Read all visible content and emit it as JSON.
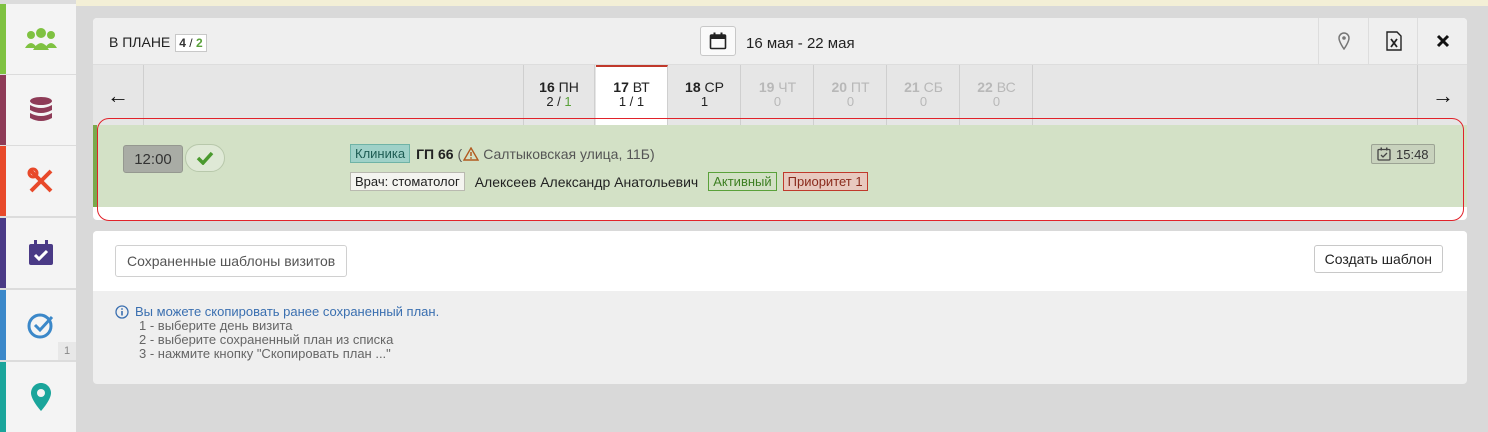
{
  "header": {
    "plan_label": "В ПЛАНЕ",
    "plan_count_total": "4",
    "plan_count_sep": "/",
    "plan_count_done": "2",
    "date_range": "16 мая - 22 мая"
  },
  "days": [
    {
      "num": "16",
      "name": "ПН",
      "count": "2 / 1",
      "state": "normal"
    },
    {
      "num": "17",
      "name": "ВТ",
      "count": "1 / 1",
      "state": "selected"
    },
    {
      "num": "18",
      "name": "СР",
      "count": "1",
      "state": "normal"
    },
    {
      "num": "19",
      "name": "ЧТ",
      "count": "0",
      "state": "off"
    },
    {
      "num": "20",
      "name": "ПТ",
      "count": "0",
      "state": "off"
    },
    {
      "num": "21",
      "name": "СБ",
      "count": "0",
      "state": "off"
    },
    {
      "num": "22",
      "name": "ВС",
      "count": "0",
      "state": "off"
    }
  ],
  "visit": {
    "time": "12:00",
    "type_tag": "Клиника",
    "name": "ГП 66",
    "paren_open": "(",
    "address": "Салтыковская улица, 11Б)",
    "doctor_tag": "Врач: стоматолог",
    "doctor_name": "Алексеев Александр Анатольевич",
    "status_tag": "Активный",
    "priority_tag": "Приоритет 1",
    "created_time": "15:48"
  },
  "templates": {
    "saved_button": "Сохраненные шаблоны визитов",
    "create_button": "Создать шаблон",
    "info_title": "Вы можете скопировать ранее сохраненный план.",
    "steps": [
      "1 - выберите день визита",
      "2 - выберите сохраненный план из списка",
      "3 - нажмите кнопку \"Скопировать план ...\""
    ]
  },
  "sidebar": {
    "badge": "1",
    "colors": [
      "#7fc241",
      "#8e3b57",
      "#e8492a",
      "#4a3a86",
      "#3b88c9",
      "#1aa59b"
    ]
  }
}
